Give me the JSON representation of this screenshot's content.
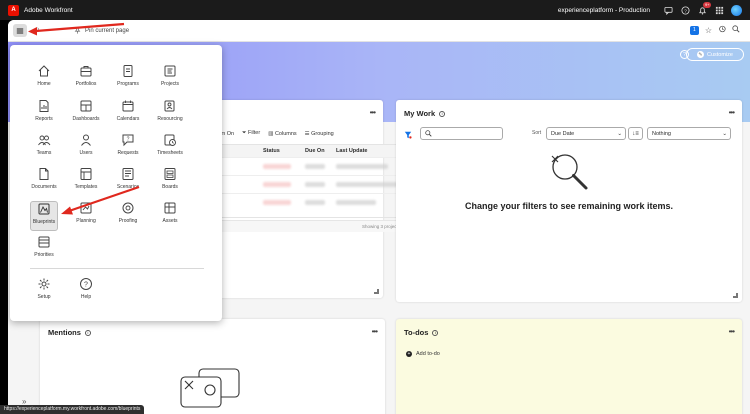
{
  "app": {
    "title": "Adobe Workfront",
    "environment": "experienceplatform - Production",
    "logo_letter": "A"
  },
  "topbar": {
    "notification_count": "9+"
  },
  "subbar": {
    "pin_label": "Pin current page",
    "count_badge": "1"
  },
  "banner": {
    "customize_label": "Customize",
    "help_symbol": "?"
  },
  "projects_card": {
    "toolbar": {
      "in_on": "I'm On",
      "filter": "Filter",
      "columns": "Columns",
      "grouping": "Grouping"
    },
    "columns": [
      "Status",
      "Due On",
      "Last Update"
    ],
    "footer": "Showing 3 projects"
  },
  "my_work": {
    "title": "My Work",
    "sort_label": "Sort",
    "sort_value": "Due Date",
    "group_value": "Nothing",
    "empty_message": "Change your filters to see remaining work items."
  },
  "mentions": {
    "title": "Mentions"
  },
  "todos": {
    "title": "To-dos",
    "add_label": "Add to-do",
    "background": "#fbfbe0"
  },
  "nav_menu": {
    "items": [
      {
        "label": "Home",
        "icon": "home-icon"
      },
      {
        "label": "Portfolios",
        "icon": "portfolio-icon"
      },
      {
        "label": "Programs",
        "icon": "programs-icon"
      },
      {
        "label": "Projects",
        "icon": "projects-icon"
      },
      {
        "label": "Reports",
        "icon": "reports-icon"
      },
      {
        "label": "Dashboards",
        "icon": "dashboards-icon"
      },
      {
        "label": "Calendars",
        "icon": "calendar-icon"
      },
      {
        "label": "Resourcing",
        "icon": "resourcing-icon"
      },
      {
        "label": "Teams",
        "icon": "teams-icon"
      },
      {
        "label": "Users",
        "icon": "user-icon"
      },
      {
        "label": "Requests",
        "icon": "requests-icon"
      },
      {
        "label": "Timesheets",
        "icon": "timesheets-icon"
      },
      {
        "label": "Documents",
        "icon": "documents-icon"
      },
      {
        "label": "Templates",
        "icon": "templates-icon"
      },
      {
        "label": "Scenarios",
        "icon": "scenarios-icon"
      },
      {
        "label": "Boards",
        "icon": "boards-icon"
      },
      {
        "label": "Blueprints",
        "icon": "blueprints-icon"
      },
      {
        "label": "Planning",
        "icon": "planning-icon"
      },
      {
        "label": "Proofing",
        "icon": "proofing-icon"
      },
      {
        "label": "Assets",
        "icon": "assets-icon"
      },
      {
        "label": "Priorities",
        "icon": "priorities-icon"
      },
      {
        "label": "Setup",
        "icon": "gear-icon"
      },
      {
        "label": "Help",
        "icon": "help-icon"
      }
    ]
  },
  "status_url": "https://experienceplatform.my.workfront.adobe.com/blueprints",
  "colors": {
    "accent": "#1473e6",
    "arrow": "#e0281e",
    "banner_start": "#8f8ff7",
    "banner_end": "#a8cbf2"
  }
}
